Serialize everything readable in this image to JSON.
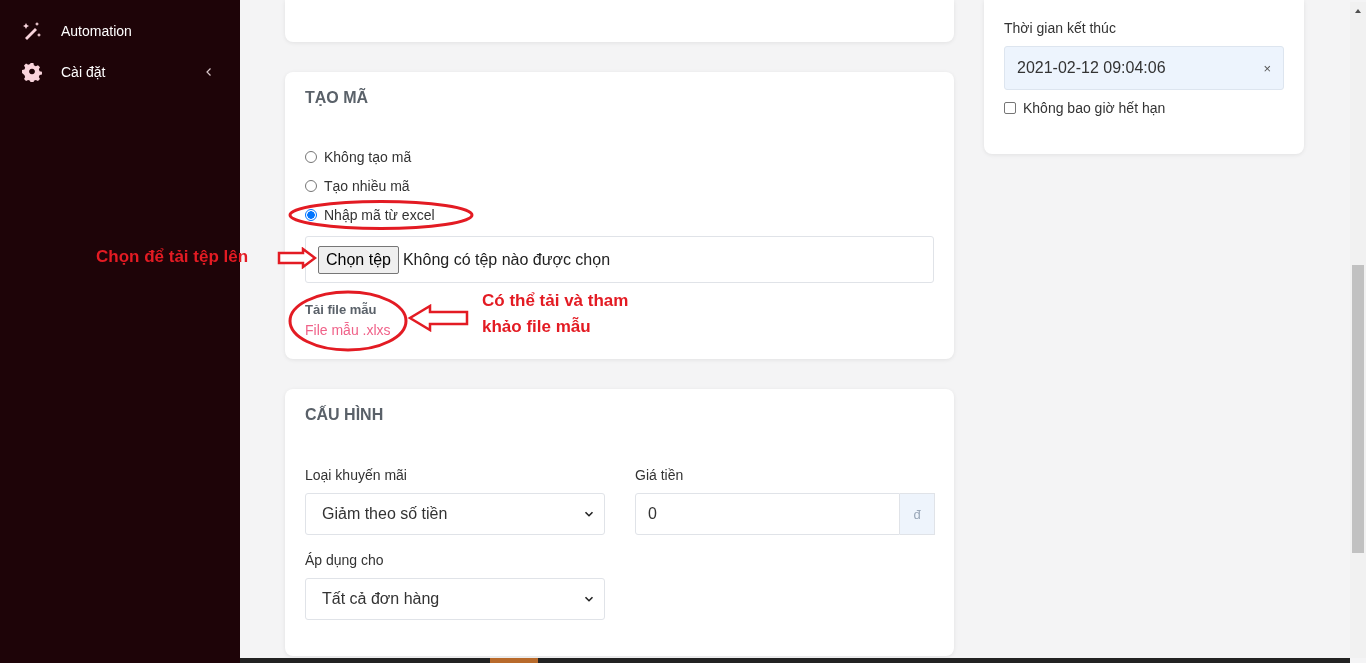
{
  "sidebar": {
    "items": [
      {
        "label": "Automation",
        "kind": "wand",
        "expandable": false
      },
      {
        "label": "Cài đặt",
        "kind": "gear",
        "expandable": true
      }
    ]
  },
  "code_section": {
    "title": "TẠO MÃ",
    "options": [
      {
        "label": "Không tạo mã",
        "selected": false
      },
      {
        "label": "Tạo nhiều mã",
        "selected": false
      },
      {
        "label": "Nhập mã từ excel",
        "selected": true
      }
    ],
    "file_input": {
      "button": "Chọn tệp",
      "status": "Không có tệp nào được chọn"
    },
    "template": {
      "label": "Tải file mẫu",
      "link": "File mẫu .xlxs"
    }
  },
  "config_section": {
    "title": "CẤU HÌNH",
    "fields": [
      {
        "kind": "select",
        "label": "Loại khuyến mãi",
        "value": "Giảm theo số tiền"
      },
      {
        "kind": "input",
        "label": "Giá tiền",
        "value": "0",
        "suffix": "đ"
      },
      {
        "kind": "select",
        "label": "Áp dụng cho",
        "value": "Tất cả đơn hàng"
      }
    ]
  },
  "end_time": {
    "label": "Thời gian kết thúc",
    "value": "2021-02-12 09:04:06",
    "clear": "×",
    "never_expire": {
      "label": "Không bao giờ hết hạn",
      "checked": false
    }
  },
  "annotations": [
    {
      "text": "Chọn để tải tệp lên"
    },
    {
      "text": "Có thể tải và tham khảo file mẫu"
    }
  ]
}
